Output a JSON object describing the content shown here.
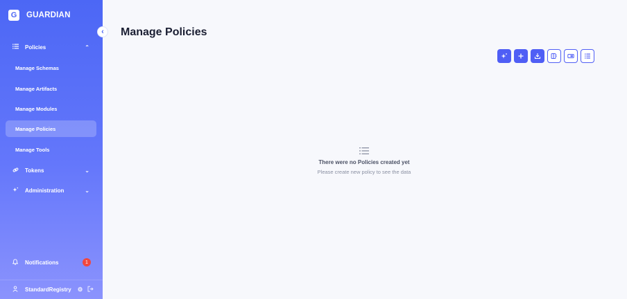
{
  "app": {
    "logo_letter": "G",
    "name": "GUARDIAN"
  },
  "sidebar": {
    "collapse_glyph": "‹",
    "policies": {
      "label": "Policies",
      "icon": "list-icon",
      "expanded": true
    },
    "sub_items": [
      {
        "label": "Manage Schemas"
      },
      {
        "label": "Manage Artifacts"
      },
      {
        "label": "Manage Modules"
      },
      {
        "label": "Manage Policies",
        "active": true
      },
      {
        "label": "Manage Tools"
      }
    ],
    "tokens": {
      "label": "Tokens",
      "icon": "link-icon"
    },
    "administration": {
      "label": "Administration",
      "icon": "sparkle-icon"
    },
    "notifications": {
      "label": "Notifications",
      "count": "1",
      "icon": "bell-icon"
    },
    "user": {
      "name": "StandardRegistry",
      "icon": "user-icon"
    }
  },
  "main": {
    "title": "Manage Policies",
    "toolbar_icons": [
      "ai-sparkle-icon",
      "plus-icon",
      "import-icon",
      "compare-icon",
      "wizard-icon",
      "list-icon"
    ],
    "empty_state": {
      "title": "There were no Policies created yet",
      "subtitle": "Please create new policy to see the data"
    }
  },
  "colors": {
    "accent": "#4f5ef5",
    "sidebar_top": "#4c67f5",
    "badge": "#f0473e"
  }
}
